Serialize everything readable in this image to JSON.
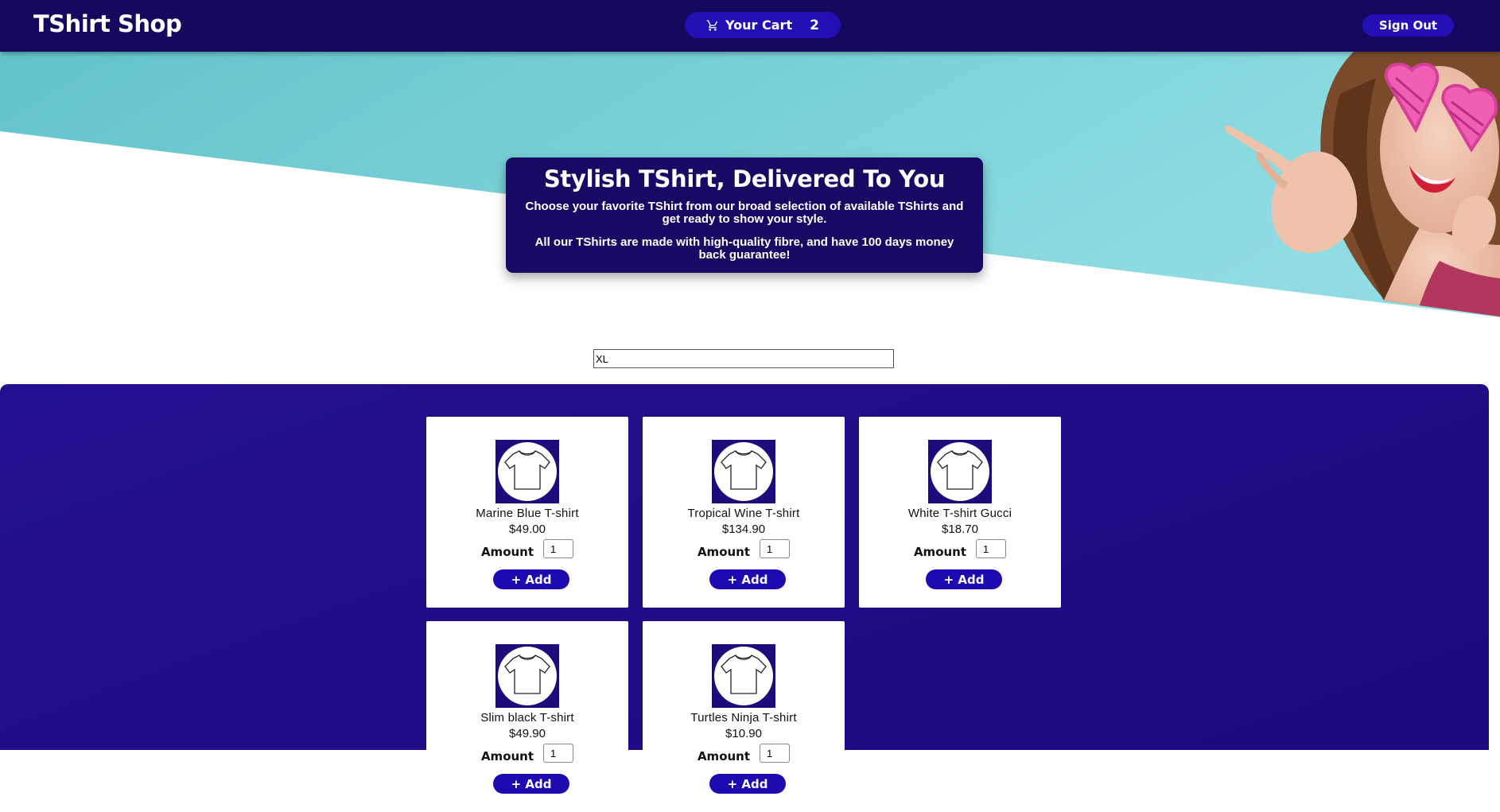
{
  "header": {
    "brand": "TShirt Shop",
    "cart_label": "Your Cart",
    "cart_count": "2",
    "cart_icon": "shopping-cart-icon",
    "signout_label": "Sign Out"
  },
  "hero": {
    "title": "Stylish TShirt, Delivered To You",
    "line1": "Choose your favorite TShirt from our broad selection of available TShirts and get ready to show your style.",
    "line2": "All our TShirts are made with high-quality fibre, and have 100 days money back guarantee!"
  },
  "filter": {
    "value": "XL"
  },
  "products": [
    {
      "name": "Marine Blue T-shirt",
      "price": "$49.00",
      "amount_label": "Amount",
      "amount": "1",
      "add_label": "+ Add"
    },
    {
      "name": "Tropical Wine T-shirt",
      "price": "$134.90",
      "amount_label": "Amount",
      "amount": "1",
      "add_label": "+ Add"
    },
    {
      "name": "White T-shirt Gucci",
      "price": "$18.70",
      "amount_label": "Amount",
      "amount": "1",
      "add_label": "+ Add"
    },
    {
      "name": "Slim black T-shirt",
      "price": "$49.90",
      "amount_label": "Amount",
      "amount": "1",
      "add_label": "+ Add"
    },
    {
      "name": "Turtles Ninja T-shirt",
      "price": "$10.90",
      "amount_label": "Amount",
      "amount": "1",
      "add_label": "+ Add"
    }
  ],
  "colors": {
    "header_bg": "#14085f",
    "accent_button": "#2210b5",
    "hero_card": "#170a64",
    "products_bg": "#200c86",
    "teal": "#6fcbd2"
  }
}
